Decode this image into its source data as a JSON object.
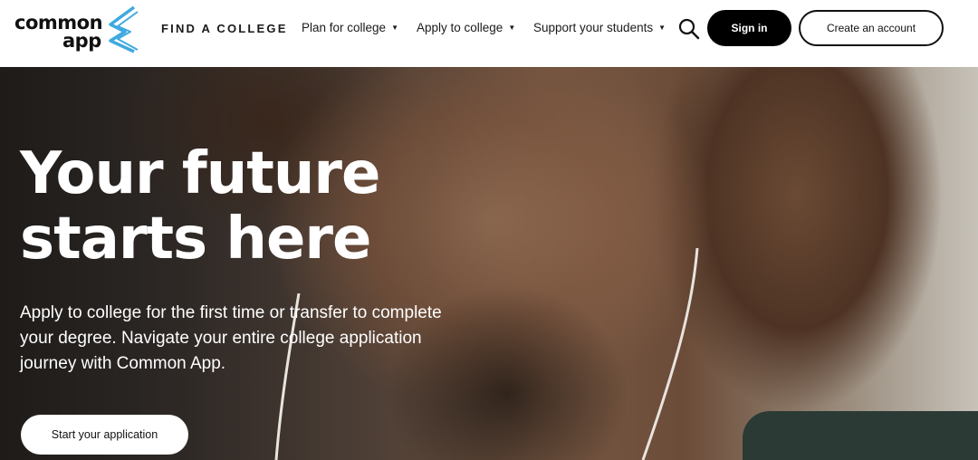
{
  "header": {
    "logo_text_line1": "common",
    "logo_text_line2": "app",
    "find_college": "FIND A COLLEGE",
    "nav": [
      {
        "label": "Plan for college"
      },
      {
        "label": "Apply to college"
      },
      {
        "label": "Support your students"
      }
    ],
    "search_icon": "search-icon",
    "sign_in": "Sign in",
    "create_account": "Create an account"
  },
  "hero": {
    "title_line1": "Your future",
    "title_line2": "starts here",
    "subtitle": "Apply to college for the first time or transfer to complete your degree. Navigate your entire college application journey with Common App.",
    "cta": "Start your application"
  },
  "colors": {
    "brand_blue": "#3fa9e0",
    "dark": "#000000",
    "white": "#ffffff"
  }
}
